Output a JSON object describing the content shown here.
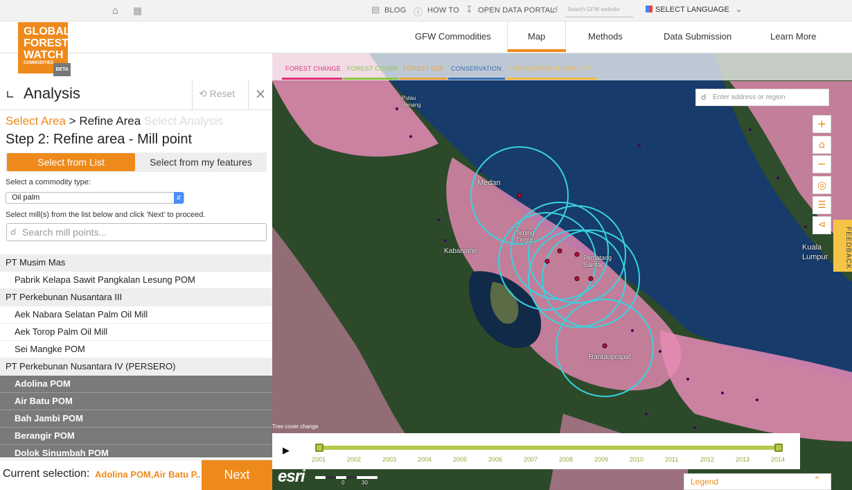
{
  "topbar": {
    "blog": "BLOG",
    "howto": "HOW TO",
    "open_data": "OPEN DATA PORTAL",
    "search_placeholder": "Search GFW website",
    "language": "SELECT LANGUAGE"
  },
  "logo": {
    "line1": "GLOBAL",
    "line2": "FOREST",
    "line3": "WATCH",
    "sub": "COMMODITIES",
    "beta": "BETA"
  },
  "nav": {
    "items": [
      "GFW Commodities",
      "Map",
      "Methods",
      "Data Submission",
      "Learn More"
    ],
    "active": "Map"
  },
  "map": {
    "layer_tabs": [
      {
        "label": "FOREST CHANGE",
        "color": "#e0307a"
      },
      {
        "label": "FOREST COVER",
        "color": "#8cc63f"
      },
      {
        "label": "FOREST USE",
        "color": "#e8a23b"
      },
      {
        "label": "CONSERVATION",
        "color": "#3a6fb0"
      },
      {
        "label": "PRODUCTION SUITABILITY",
        "color": "#f4b942"
      }
    ],
    "address_placeholder": "Enter address or region",
    "labels": {
      "medan": "Medan",
      "kabanjahe": "Kabanjahe",
      "tebing": "Tebing\nTinggi",
      "pematang": "Pematang\nSiantar",
      "rantau": "Rantauprapat",
      "kuala": "Kuala\nLumpur",
      "pulau": "Pulau\nPenang"
    },
    "attribution": "Tree cover change",
    "feedback": "FEEDBACK",
    "legend": "Legend",
    "esri": "esri",
    "scale_labels": [
      "0",
      "30"
    ],
    "colors": {
      "accent": "#ee8a1c",
      "loss": "#e88bb5",
      "forest": "#2c4a2a",
      "water": "#173b6a",
      "circle": "#37d3e0"
    }
  },
  "timeline": {
    "years": [
      "2001",
      "2002",
      "2003",
      "2004",
      "2005",
      "2006",
      "2007",
      "2008",
      "2009",
      "2010",
      "2011",
      "2012",
      "2013",
      "2014"
    ],
    "range": [
      2001,
      2014
    ]
  },
  "panel": {
    "title": "Analysis",
    "reset": "Reset",
    "crumb_1": "Select Area",
    "crumb_sep": " > ",
    "crumb_2": "Refine Area",
    "crumb_3": "Select Analysis",
    "step": "Step 2: Refine area - Mill point",
    "seg_list": "Select from List",
    "seg_features": "Select from my features",
    "commodity_label": "Select a commodity type:",
    "commodity_value": "Oil palm",
    "mills_label": "Select mill(s) from the list below and click 'Next' to proceed.",
    "search_placeholder": "Search mill points...",
    "rows": [
      {
        "type": "grp",
        "text": "PT Musim Mas"
      },
      {
        "type": "item",
        "text": "Pabrik Kelapa Sawit Pangkalan Lesung POM"
      },
      {
        "type": "grp",
        "text": "PT Perkebunan Nusantara III"
      },
      {
        "type": "item",
        "text": "Aek Nabara Selatan Palm Oil Mill"
      },
      {
        "type": "item",
        "text": "Aek Torop Palm Oil Mill"
      },
      {
        "type": "item",
        "text": "Sei Mangke POM"
      },
      {
        "type": "grp",
        "text": "PT Perkebunan Nusantara IV (PERSERO)"
      },
      {
        "type": "sel",
        "text": "Adolina POM"
      },
      {
        "type": "sel",
        "text": "Air Batu POM"
      },
      {
        "type": "sel",
        "text": "Bah Jambi POM"
      },
      {
        "type": "sel",
        "text": "Berangir POM"
      },
      {
        "type": "sel",
        "text": "Dolok Sinumbah POM"
      }
    ],
    "current_label": "Current selection:",
    "current_value": "Adolina POM,Air Batu P...",
    "next": "Next"
  }
}
